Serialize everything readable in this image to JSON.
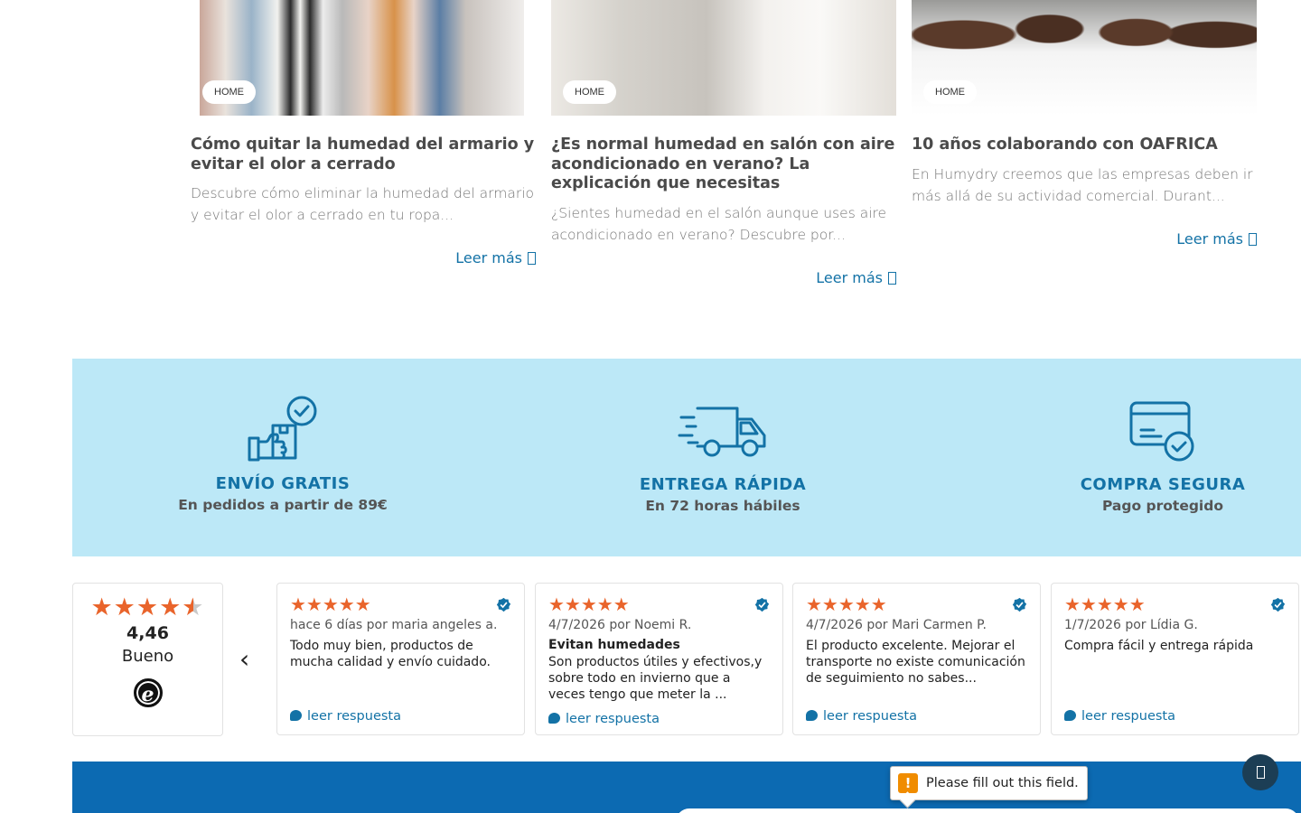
{
  "blog": [
    {
      "badge": "HOME",
      "title": "Cómo quitar la humedad del armario y evitar el olor a cerrado",
      "excerpt": "Descubre cómo eliminar la humedad del armario y evitar el olor a cerrado en tu ropa...",
      "more": "Leer más"
    },
    {
      "badge": "HOME",
      "title": "¿Es normal humedad en salón con aire acondicionado en verano? La explicación que necesitas",
      "excerpt": "¿Sientes humedad en el salón aunque uses aire acondicionado en verano? Descubre por...",
      "more": "Leer más"
    },
    {
      "badge": "HOME",
      "title": "10 años colaborando con OAFRICA",
      "excerpt": "En Humydry creemos que las empresas deben ir más allá de su actividad comercial. Durant...",
      "more": "Leer más"
    }
  ],
  "benefits": [
    {
      "title": "ENVÍO GRATIS",
      "subtitle": "En pedidos a partir de 89€",
      "icon": "package-check-icon"
    },
    {
      "title": "ENTREGA RÁPIDA",
      "subtitle": "En 72 horas hábiles",
      "icon": "fast-truck-icon"
    },
    {
      "title": "COMPRA SEGURA",
      "subtitle": "Pago protegido",
      "icon": "secure-card-icon"
    }
  ],
  "rating_summary": {
    "stars": "★★★★",
    "half_star": "★",
    "score": "4,46",
    "label": "Bueno",
    "logo": "e"
  },
  "reviews": [
    {
      "stars": "★★★★★",
      "meta": "hace 6 días por maria angeles a.",
      "title": "",
      "body": "Todo muy bien, productos de mucha calidad y envío cuidado.",
      "reply": "leer respuesta"
    },
    {
      "stars": "★★★★★",
      "meta": "4/7/2026 por Noemi R.",
      "title": "Evitan humedades",
      "body": "Son productos útiles y efectivos,y sobre todo en invierno que a veces tengo que meter la ...",
      "reply": "leer respuesta"
    },
    {
      "stars": "★★★★★",
      "meta": "4/7/2026 por Mari Carmen P.",
      "title": "",
      "body": "El producto excelente. Mejorar el transporte no existe comunicación de seguimiento no sabes...",
      "reply": "leer respuesta"
    },
    {
      "stars": "★★★★★",
      "meta": "1/7/2026 por Lídia G.",
      "title": "",
      "body": "Compra fácil y entrega rápida",
      "reply": "leer respuesta"
    }
  ],
  "nav": {
    "prev_arrow": "‹"
  },
  "tooltip": {
    "icon": "!",
    "text": "Please fill out this field."
  },
  "colors": {
    "accent": "#1372a6",
    "band": "#bce8f7",
    "star": "#e9642b",
    "footer": "#0c6ab2"
  }
}
